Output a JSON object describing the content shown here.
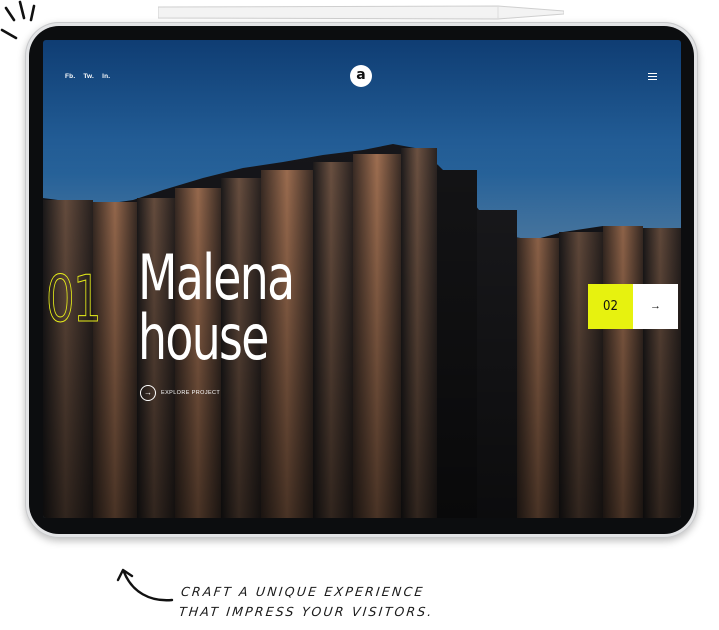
{
  "nav": {
    "social": [
      {
        "label": "Fb."
      },
      {
        "label": "Tw."
      },
      {
        "label": "In."
      }
    ],
    "logo_letter": "a",
    "menu_icon": "hamburger-icon"
  },
  "hero": {
    "slide_number": "01",
    "title_line1": "Malena",
    "title_line2": "house",
    "cta_label": "EXPLORE PROJECT",
    "cta_icon": "arrow-right-icon"
  },
  "next_slide": {
    "number": "02",
    "arrow_icon": "arrow-right-icon",
    "accent": "#e7f20f"
  },
  "caption": {
    "line1": "CRAFT A UNIQUE EXPERIENCE",
    "line2": "THAT IMPRESS YOUR VISITORS."
  }
}
